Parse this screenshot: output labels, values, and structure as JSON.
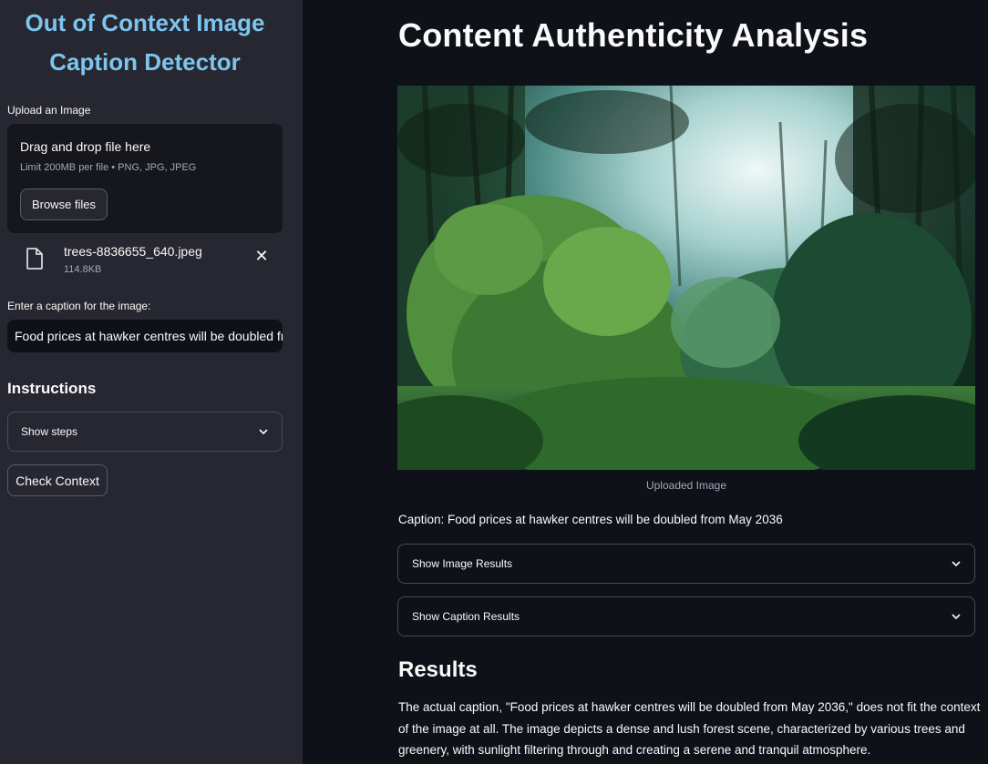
{
  "sidebar": {
    "title_line1": "Out of Context Image",
    "title_line2": "Caption Detector",
    "upload_label": "Upload an Image",
    "uploader": {
      "drag_text": "Drag and drop file here",
      "limit_text": "Limit 200MB per file • PNG, JPG, JPEG",
      "browse_label": "Browse files"
    },
    "file": {
      "name": "trees-8836655_640.jpeg",
      "size": "114.8KB"
    },
    "caption_label": "Enter a caption for the image:",
    "caption_value": "Food prices at hawker centres will be doubled fr",
    "instructions_heading": "Instructions",
    "show_steps_label": "Show steps",
    "check_button_label": "Check Context"
  },
  "main": {
    "title": "Content Authenticity Analysis",
    "image_caption": "Uploaded Image",
    "caption_line": "Caption: Food prices at hawker centres will be doubled from May 2036",
    "image_results_label": "Show Image Results",
    "caption_results_label": "Show Caption Results",
    "results_heading": "Results",
    "results_text": "The actual caption, \"Food prices at hawker centres will be doubled from May 2036,\" does not fit the context of the image at all. The image depicts a dense and lush forest scene, characterized by various trees and greenery, with sunlight filtering through and creating a serene and tranquil atmosphere."
  },
  "colors": {
    "background": "#0e1117",
    "sidebar": "#262730",
    "title_accent": "#7cc5ee"
  },
  "icons": {
    "file": "file-icon",
    "close": "close-icon",
    "chevron": "chevron-down-icon"
  }
}
